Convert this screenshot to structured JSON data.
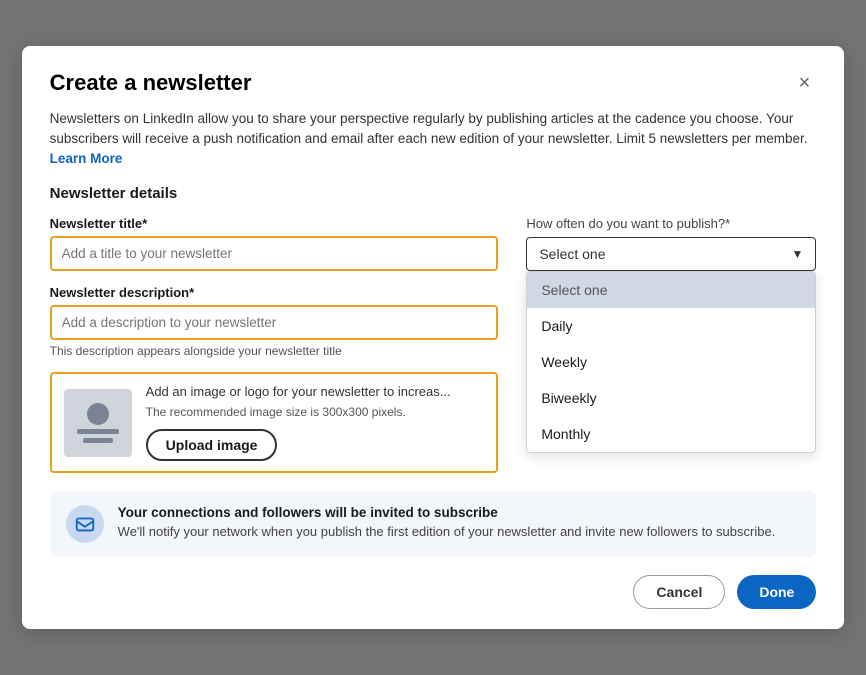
{
  "modal": {
    "title": "Create a newsletter",
    "close_label": "×",
    "intro": "Newsletters on LinkedIn allow you to share your perspective regularly by publishing articles at the cadence you choose. Your subscribers will receive a push notification and email after each new edition of your newsletter. Limit 5 newsletters per member.",
    "learn_more": "Learn More",
    "section_title": "Newsletter details",
    "title_field": {
      "label": "Newsletter title*",
      "placeholder": "Add a title to your newsletter"
    },
    "description_field": {
      "label": "Newsletter description*",
      "placeholder": "Add a description to your newsletter",
      "helper": "This description appears alongside your newsletter title"
    },
    "image_section": {
      "desc": "Add an image or logo for your newsletter to increas...",
      "rec": "The recommended image size is 300x300 pixels.",
      "upload_btn": "Upload image"
    },
    "frequency": {
      "label": "How often do you want to publish?*",
      "placeholder": "Select one",
      "options": [
        {
          "value": "select_one",
          "label": "Select one",
          "selected": true
        },
        {
          "value": "daily",
          "label": "Daily"
        },
        {
          "value": "weekly",
          "label": "Weekly"
        },
        {
          "value": "biweekly",
          "label": "Biweekly"
        },
        {
          "value": "monthly",
          "label": "Monthly"
        }
      ]
    },
    "notification": {
      "title": "Your connections and followers will be invited to subscribe",
      "desc": "We'll notify your network when you publish the first edition of your newsletter and invite new followers to subscribe."
    },
    "footer": {
      "cancel": "Cancel",
      "done": "Done"
    }
  }
}
